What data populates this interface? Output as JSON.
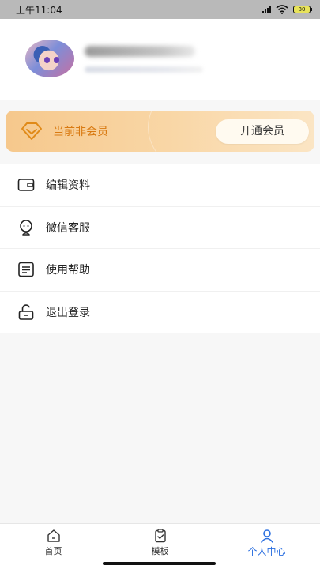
{
  "status_bar": {
    "time": "上午11:04",
    "battery": "80"
  },
  "vip": {
    "status_text": "当前非会员",
    "button_label": "开通会员"
  },
  "menu": [
    {
      "label": "编辑资料",
      "icon": "wallet-icon"
    },
    {
      "label": "微信客服",
      "icon": "wechat-service-icon"
    },
    {
      "label": "使用帮助",
      "icon": "help-doc-icon"
    },
    {
      "label": "退出登录",
      "icon": "logout-lock-icon"
    }
  ],
  "bottom_nav": [
    {
      "label": "首页",
      "icon": "home-icon",
      "active": false
    },
    {
      "label": "模板",
      "icon": "template-icon",
      "active": false
    },
    {
      "label": "个人中心",
      "icon": "user-icon",
      "active": true
    }
  ],
  "colors": {
    "accent": "#2b6fe0",
    "vip_text": "#d97a12",
    "vip_card": "#f6c88c"
  }
}
